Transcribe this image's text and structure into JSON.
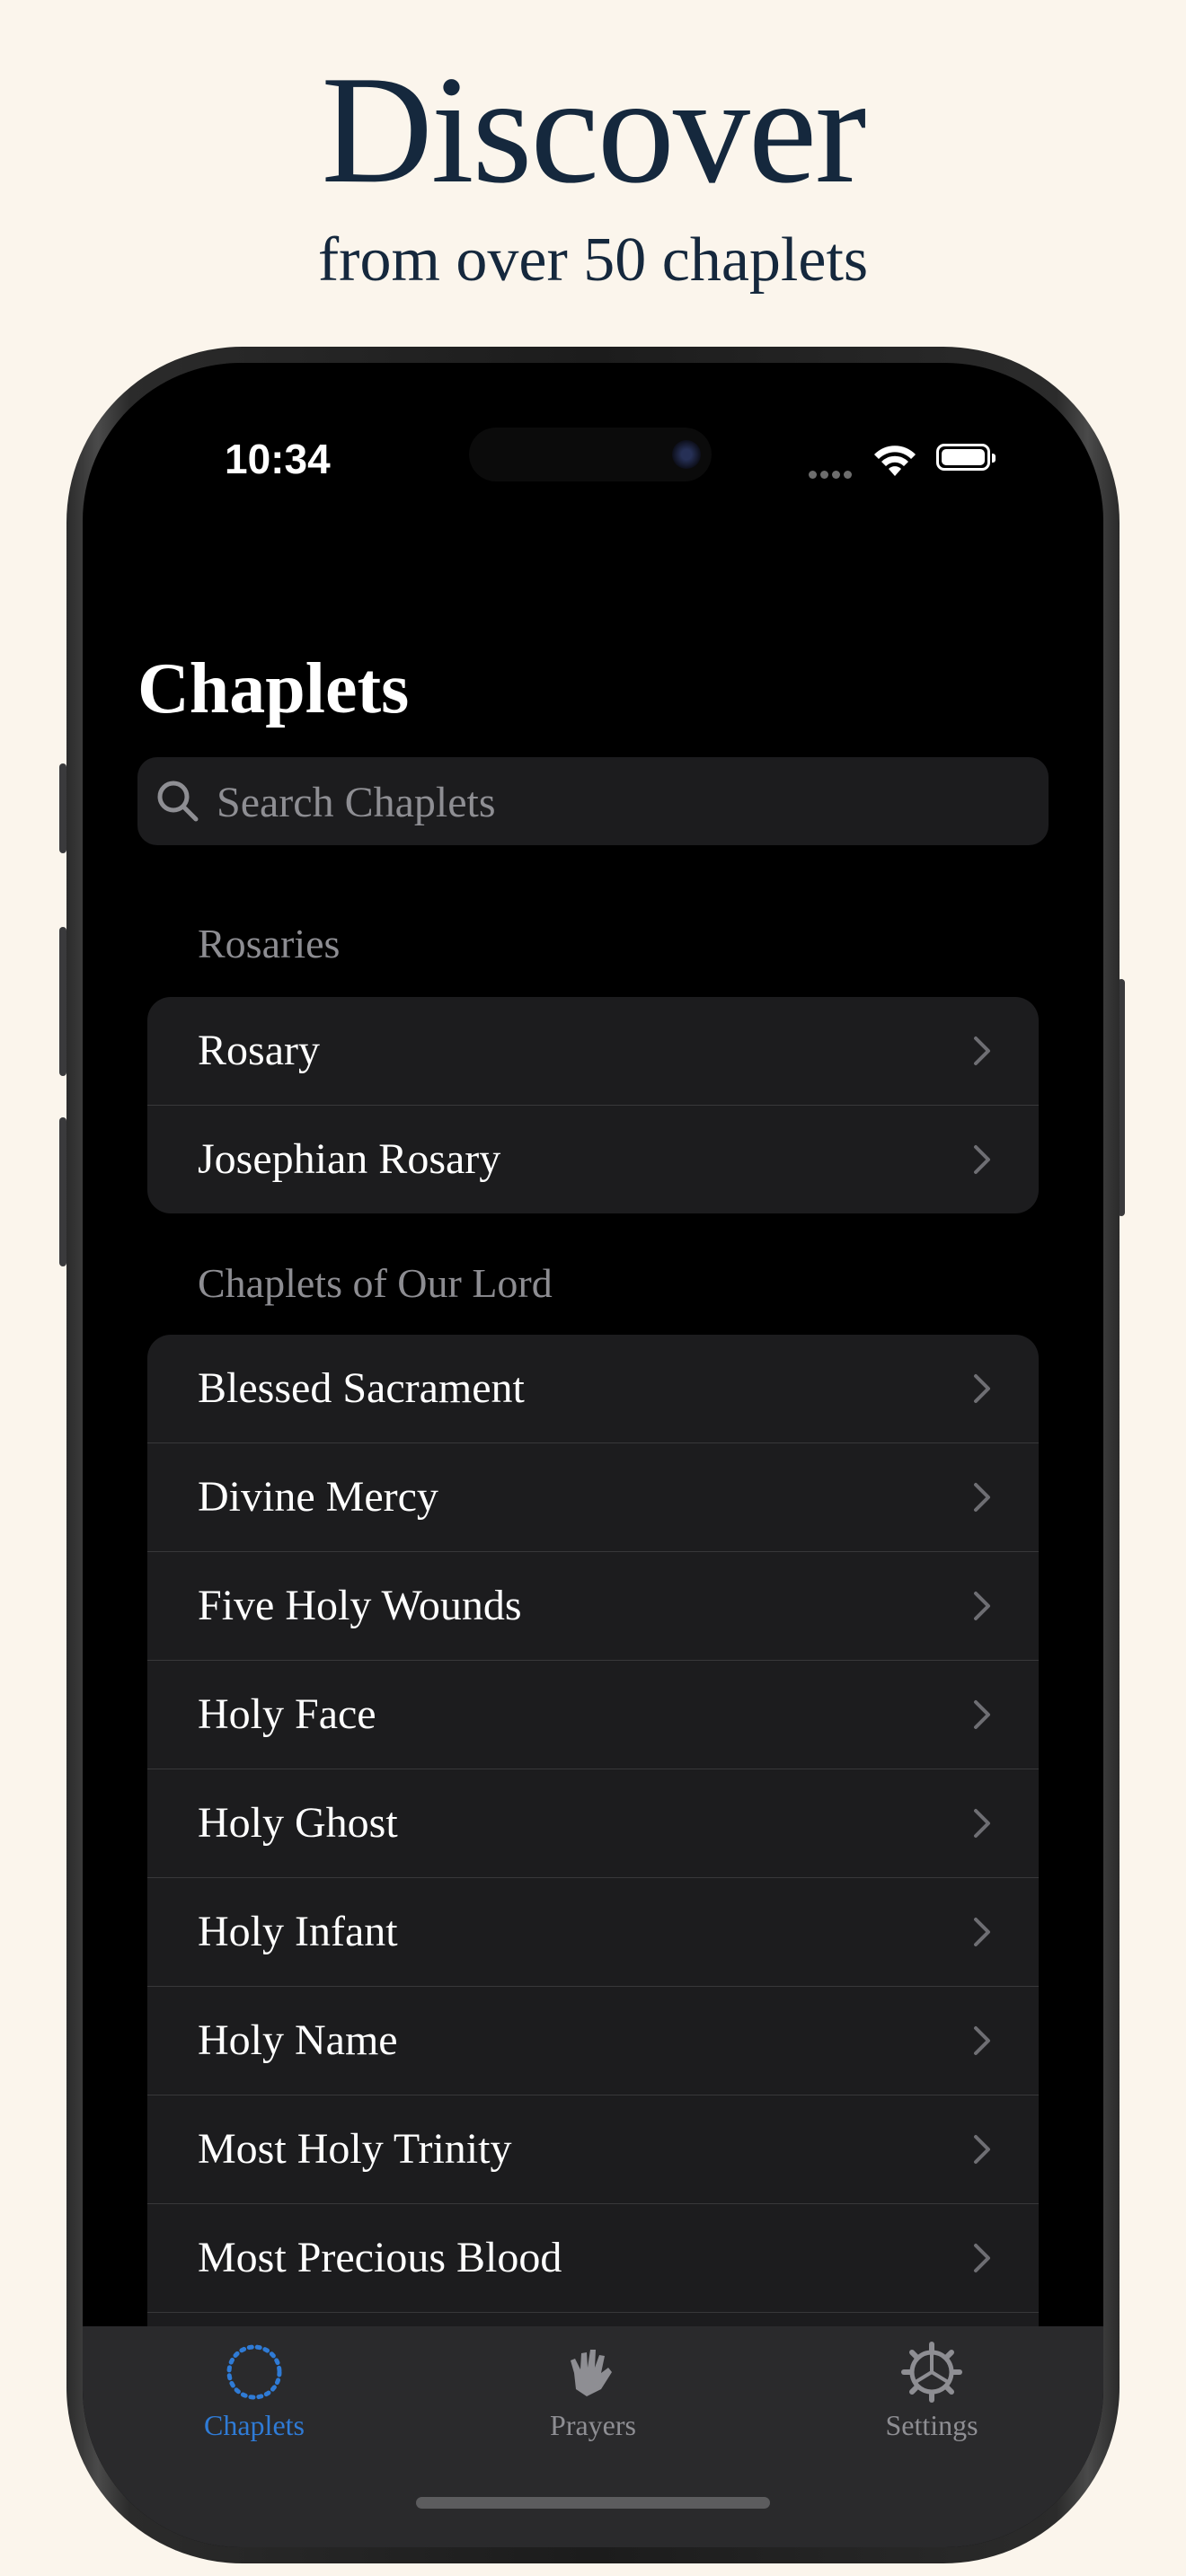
{
  "promo": {
    "headline": "Discover",
    "subheadline": "from over 50 chaplets"
  },
  "status_bar": {
    "time": "10:34"
  },
  "nav": {
    "title": "Chaplets"
  },
  "search": {
    "placeholder": "Search Chaplets"
  },
  "sections": [
    {
      "header": "Rosaries",
      "items": [
        "Rosary",
        "Josephian Rosary"
      ]
    },
    {
      "header": "Chaplets of Our Lord",
      "items": [
        "Blessed Sacrament",
        "Divine Mercy",
        "Five Holy Wounds",
        "Holy Face",
        "Holy Ghost",
        "Holy Infant",
        "Holy Name",
        "Most Holy Trinity",
        "Most Precious Blood"
      ]
    }
  ],
  "tabbar": {
    "tabs": [
      {
        "label": "Chaplets",
        "icon": "rosary-circle-icon",
        "active": true
      },
      {
        "label": "Prayers",
        "icon": "praying-hands-icon",
        "active": false
      },
      {
        "label": "Settings",
        "icon": "gear-icon",
        "active": false
      }
    ]
  },
  "colors": {
    "background": "#fbf5ec",
    "headline": "#15283d",
    "accent": "#2f7bd6",
    "inactive_tab": "#8e8e93"
  }
}
